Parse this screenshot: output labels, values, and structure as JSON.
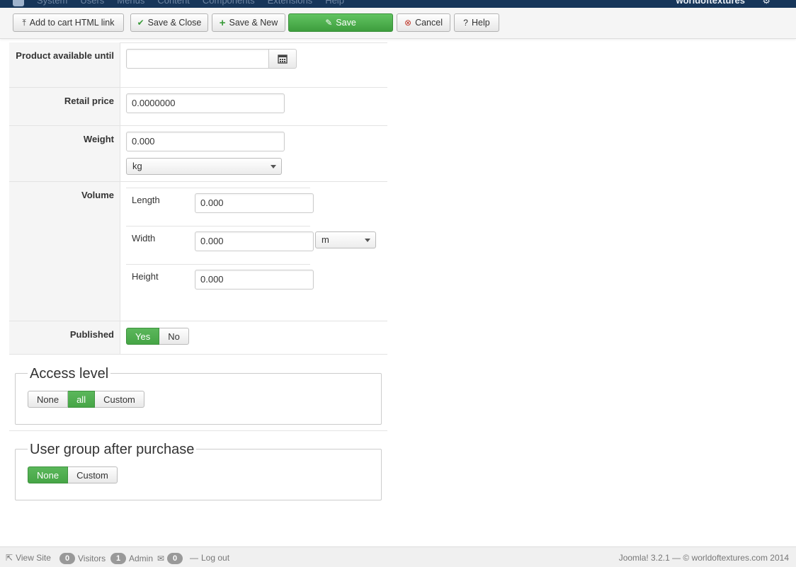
{
  "topnav": {
    "menu": [
      "System",
      "Users",
      "Menus",
      "Content",
      "Components",
      "Extensions",
      "Help"
    ],
    "user": "worldoftextures",
    "icons": {
      "logo": "joomla-logo-icon",
      "gear": "gear-icon"
    }
  },
  "toolbar": {
    "add_to_cart": "Add to cart HTML link",
    "save_close": "Save & Close",
    "save_new": "Save & New",
    "save": "Save",
    "cancel": "Cancel",
    "help": "Help"
  },
  "form": {
    "available_until": {
      "label": "Product available until",
      "value": ""
    },
    "retail_price": {
      "label": "Retail price",
      "value": "0.0000000"
    },
    "weight": {
      "label": "Weight",
      "value": "0.000",
      "unit": "kg"
    },
    "volume": {
      "label": "Volume",
      "length": {
        "label": "Length",
        "value": "0.000"
      },
      "width": {
        "label": "Width",
        "value": "0.000"
      },
      "height": {
        "label": "Height",
        "value": "0.000"
      },
      "unit": "m"
    },
    "published": {
      "label": "Published",
      "yes": "Yes",
      "no": "No",
      "selected": "Yes"
    }
  },
  "access_level": {
    "legend": "Access level",
    "options": [
      "None",
      "all",
      "Custom"
    ],
    "selected": "all"
  },
  "user_group": {
    "legend": "User group after purchase",
    "options": [
      "None",
      "Custom"
    ],
    "selected": "None"
  },
  "statusbar": {
    "view_site": "View Site",
    "visitors_count": "0",
    "visitors": "Visitors",
    "admin_count": "1",
    "admin": "Admin",
    "messages_count": "0",
    "logout": "Log out",
    "footer": "Joomla! 3.2.1  —  © worldoftextures.com 2014"
  },
  "colors": {
    "accent_green": "#46a546",
    "nav_bg": "#17365a"
  }
}
